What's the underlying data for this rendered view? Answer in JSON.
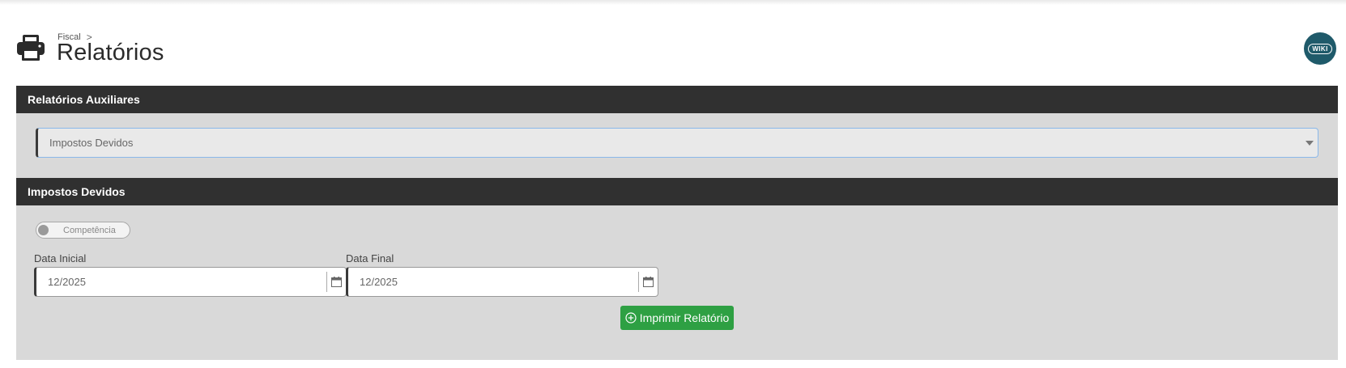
{
  "breadcrumb": {
    "parent": "Fiscal",
    "separator": ">"
  },
  "page": {
    "title": "Relatórios"
  },
  "wiki": {
    "label": "WIKI"
  },
  "section_auxiliares": {
    "title": "Relatórios Auxiliares",
    "select_value": "Impostos Devidos"
  },
  "section_impostos": {
    "title": "Impostos Devidos",
    "toggle_label": "Competência",
    "data_inicial_label": "Data Inicial",
    "data_inicial_value": "12/2025",
    "data_final_label": "Data Final",
    "data_final_value": "12/2025",
    "print_button": "Imprimir Relatório"
  },
  "colors": {
    "panel_header": "#303030",
    "panel_body": "#d9d9d9",
    "button": "#2ea043",
    "wiki": "#1f5a6a"
  },
  "icons": [
    "printer-icon",
    "chevron-right-icon",
    "wiki-icon",
    "dropdown-caret-icon",
    "calendar-icon",
    "plus-circle-icon"
  ]
}
